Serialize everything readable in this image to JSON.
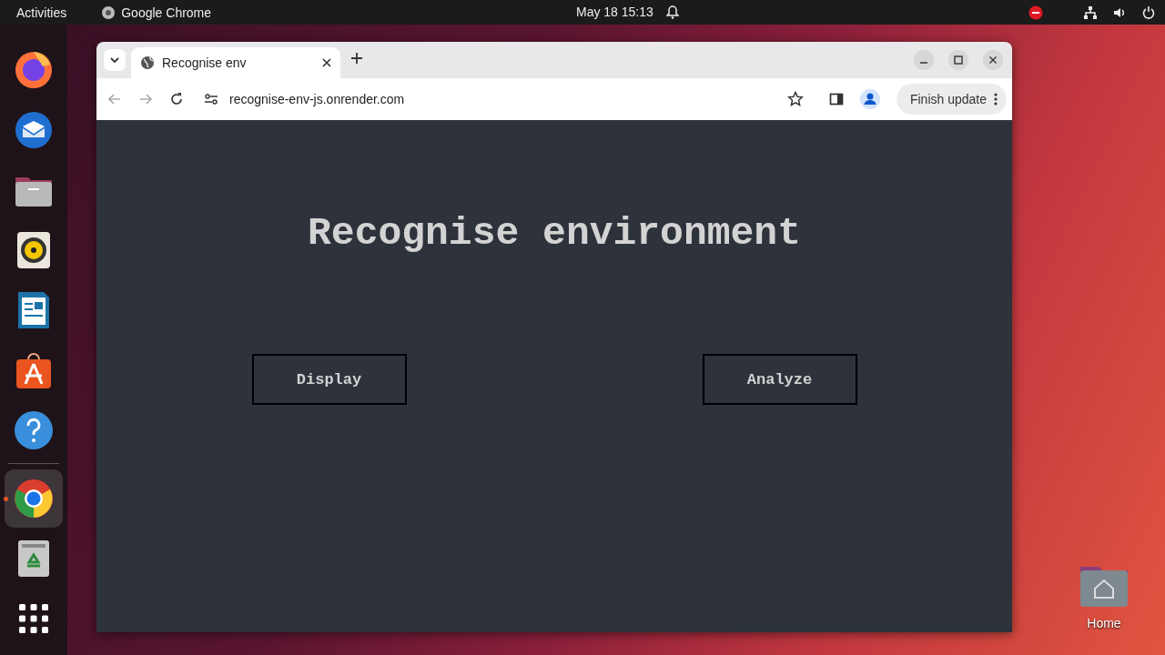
{
  "top_bar": {
    "activities": "Activities",
    "app_name": "Google Chrome",
    "clock": "May 18  15:13"
  },
  "dock": {
    "items": [
      {
        "active": false
      },
      {
        "active": false
      },
      {
        "active": false
      },
      {
        "active": false
      },
      {
        "active": false
      },
      {
        "active": false
      },
      {
        "active": false
      },
      {
        "active": true
      },
      {
        "active": false
      },
      {
        "active": false
      }
    ]
  },
  "browser": {
    "tabs": [
      {
        "title": "Recognise env",
        "selected": true
      }
    ],
    "address": "recognise-env-js.onrender.com",
    "update_button": "Finish update"
  },
  "page": {
    "heading": "Recognise environment",
    "buttons": [
      "Display",
      "Analyze"
    ]
  },
  "desktop": {
    "icons": [
      {
        "label": "Home"
      }
    ]
  }
}
